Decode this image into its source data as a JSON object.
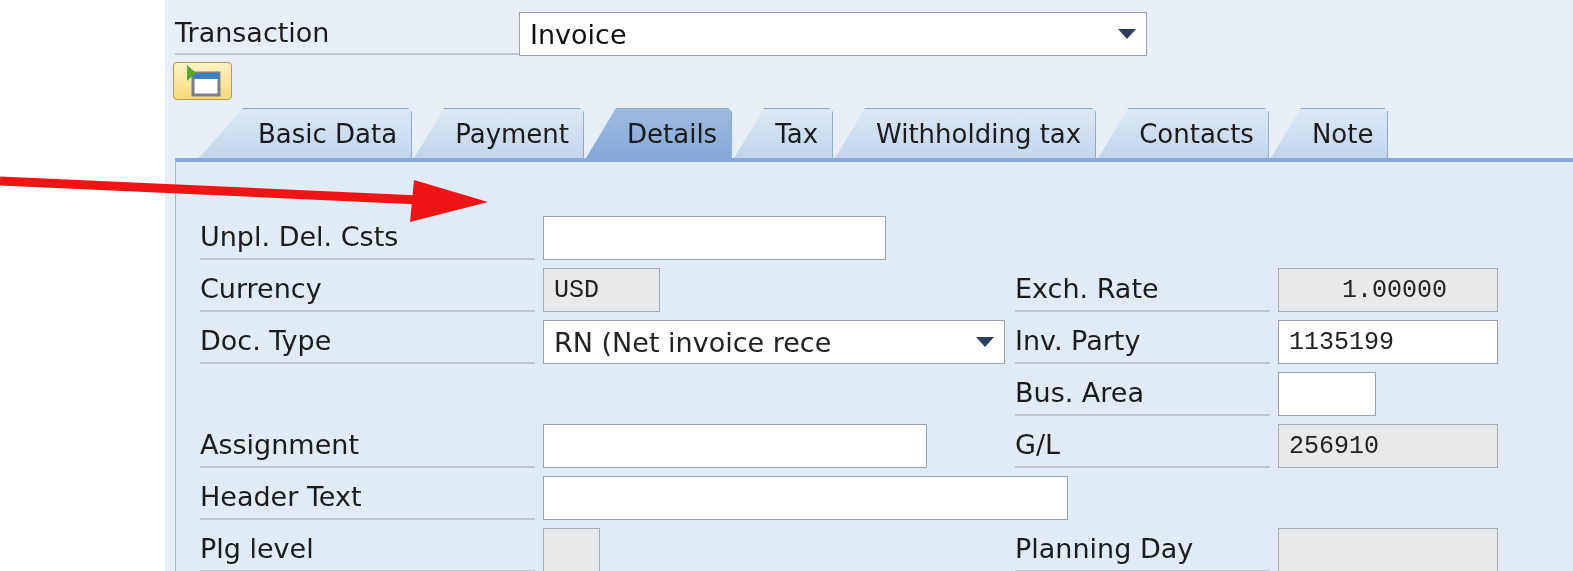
{
  "transaction": {
    "label": "Transaction",
    "value": "Invoice"
  },
  "tabs": [
    {
      "label": "Basic Data",
      "selected": false
    },
    {
      "label": "Payment",
      "selected": false
    },
    {
      "label": "Details",
      "selected": true
    },
    {
      "label": "Tax",
      "selected": false
    },
    {
      "label": "Withholding tax",
      "selected": false
    },
    {
      "label": "Contacts",
      "selected": false
    },
    {
      "label": "Note",
      "selected": false
    }
  ],
  "rows": [
    {
      "left": {
        "label": "Unpl. Del. Csts",
        "kind": "text",
        "disabled": false
      }
    },
    {
      "left": {
        "label": "Currency",
        "kind": "text",
        "value": "USD",
        "disabled": true
      },
      "right": {
        "label": "Exch. Rate",
        "kind": "number",
        "value": "1.00000",
        "disabled": true
      }
    },
    {
      "left": {
        "label": "Doc. Type",
        "kind": "dropdown",
        "value": "RN (Net invoice rece",
        "disabled": false
      },
      "right": {
        "label": "Inv. Party",
        "kind": "text",
        "value": "1135199",
        "disabled": false
      }
    },
    {
      "right": {
        "label": "Bus. Area",
        "kind": "text",
        "disabled": false
      }
    },
    {
      "left": {
        "label": "Assignment",
        "kind": "text",
        "disabled": false
      },
      "right": {
        "label": "G/L",
        "kind": "text",
        "value": "256910",
        "disabled": true
      }
    },
    {
      "left": {
        "label": "Header Text",
        "kind": "text",
        "disabled": false
      }
    },
    {
      "left": {
        "label": "Plg level",
        "kind": "text",
        "disabled": true
      },
      "right": {
        "label": "Planning Day",
        "kind": "text",
        "disabled": true
      }
    }
  ]
}
